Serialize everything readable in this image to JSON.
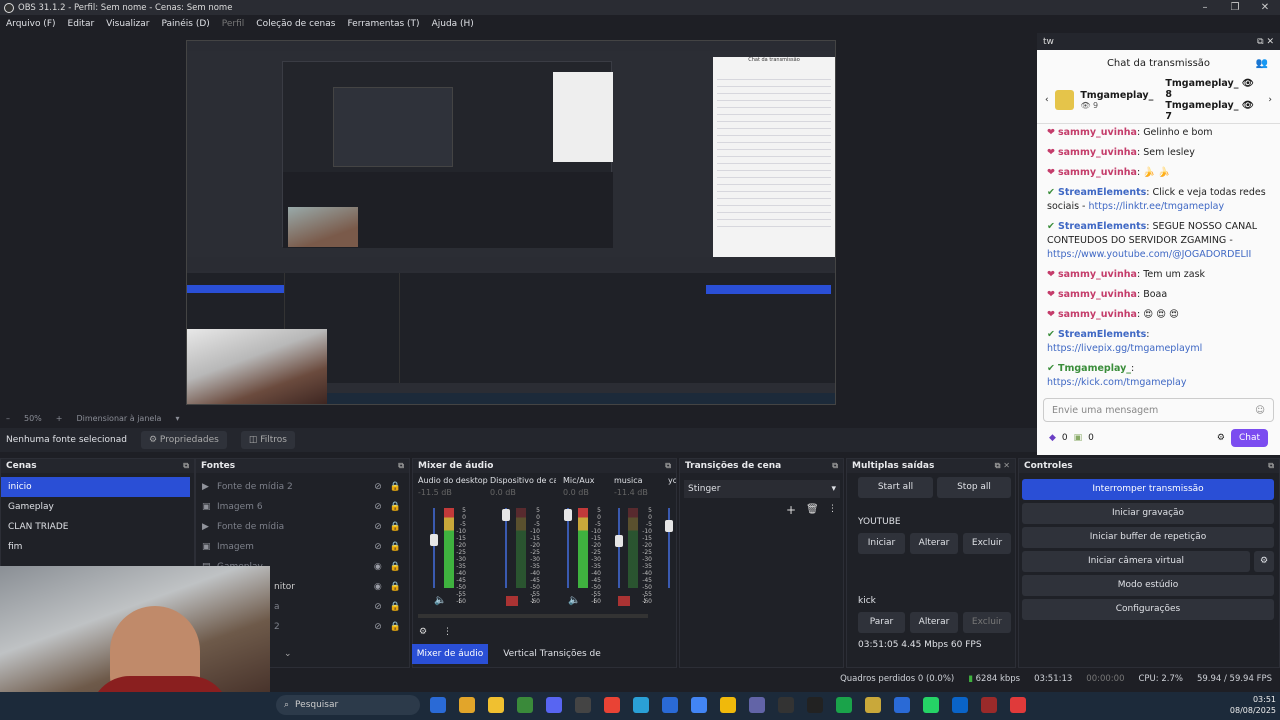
{
  "window": {
    "title": "OBS 31.1.2 - Perfil: Sem nome - Cenas: Sem nome"
  },
  "menu": [
    "Arquivo (F)",
    "Editar",
    "Visualizar",
    "Painéis (D)",
    "Perfil",
    "Coleção de cenas",
    "Ferramentas (T)",
    "Ajuda (H)"
  ],
  "zoom": {
    "percent": "50%",
    "mode": "Dimensionar à janela"
  },
  "source_bar": {
    "no_source": "Nenhuma fonte selecionad",
    "properties": "Propriedades",
    "filters": "Filtros"
  },
  "scenes": {
    "title": "Cenas",
    "items": [
      "inicio",
      "Gameplay",
      "CLAN TRIADE",
      "fim"
    ],
    "active": 0
  },
  "sources": {
    "title": "Fontes",
    "items": [
      {
        "icon": "play-icon",
        "label": "Fonte de mídia 2"
      },
      {
        "icon": "image-icon",
        "label": "Imagem 6"
      },
      {
        "icon": "play-icon",
        "label": "Fonte de mídia"
      },
      {
        "icon": "image-icon",
        "label": "Imagem"
      },
      {
        "icon": "scene-icon",
        "label": "Gameplay"
      },
      {
        "icon": "monitor-icon",
        "label": "nitor"
      },
      {
        "icon": "image-icon",
        "label": "a"
      },
      {
        "icon": "image-icon",
        "label": "2"
      }
    ]
  },
  "mixer": {
    "title": "Mixer de áudio",
    "channels": [
      {
        "name": "Áudio do desktop",
        "db": "-11.5 dB",
        "level": 0.55
      },
      {
        "name": "Dispositivo de capt",
        "db": "0.0 dB",
        "level": 0.0
      },
      {
        "name": "Mic/Aux",
        "db": "0.0 dB",
        "level": 0.9
      },
      {
        "name": "musica",
        "db": "-11.4 dB",
        "level": 0.3
      },
      {
        "name": "yo",
        "db": "",
        "level": 0.0
      }
    ],
    "scale": [
      "5",
      "0",
      "-5",
      "-10",
      "-15",
      "-20",
      "-25",
      "-30",
      "-35",
      "-40",
      "-45",
      "-50",
      "-55",
      "-60"
    ],
    "tabs": [
      "Mixer de áudio",
      "Vertical Transições de cena"
    ]
  },
  "transitions": {
    "title": "Transições de cena",
    "selected": "Stinger"
  },
  "multi": {
    "title": "Multiplas saídas",
    "start_all": "Start all",
    "stop_all": "Stop all",
    "yt_label": "YOUTUBE",
    "yt_buttons": [
      "Iniciar",
      "Alterar",
      "Excluir"
    ],
    "kick_label": "kick",
    "kick_buttons": [
      "Parar",
      "Alterar",
      "Excluir"
    ],
    "kick_stats": "03:51:05  4.45 Mbps  60 FPS"
  },
  "controls": {
    "title": "Controles",
    "buttons": [
      "Interromper transmissão",
      "Iniciar gravação",
      "Iniciar buffer de repetição",
      "Iniciar câmera virtual",
      "Modo estúdio",
      "Configurações"
    ]
  },
  "chat": {
    "dock": "tw",
    "title": "Chat da transmissão",
    "streamers": [
      {
        "name": "Tmgameplay_",
        "count": "9"
      },
      {
        "name": "Tmgameplay_",
        "count": "8"
      },
      {
        "name": "Tmgameplay_",
        "count": "7"
      }
    ],
    "messages": [
      {
        "user": "sammy_uvinha",
        "color": "red",
        "text": "Gelinho e bom"
      },
      {
        "user": "sammy_uvinha",
        "color": "red",
        "text": "Sem lesley"
      },
      {
        "user": "sammy_uvinha",
        "color": "red",
        "text": "🍌 🍌"
      },
      {
        "user": "StreamElements",
        "color": "blue",
        "text": "Click e veja todas redes sociais - ",
        "link": "https://linktr.ee/tmgameplay"
      },
      {
        "user": "StreamElements",
        "color": "blue",
        "text": "SEGUE NOSSO CANAL CONTEUDOS DO SERVIDOR ZGAMING - ",
        "link": "https://www.youtube.com/@JOGADORDELII"
      },
      {
        "user": "sammy_uvinha",
        "color": "red",
        "text": "Tem um zask"
      },
      {
        "user": "sammy_uvinha",
        "color": "red",
        "text": "Boaa"
      },
      {
        "user": "sammy_uvinha",
        "color": "red",
        "text": "😍 😍 😍"
      },
      {
        "user": "StreamElements",
        "color": "blue",
        "text": "",
        "link": "https://livepix.gg/tmgameplayml"
      },
      {
        "user": "Tmgameplay_",
        "color": "green",
        "text": "",
        "link": "https://kick.com/tmgameplay"
      }
    ],
    "input_placeholder": "Envie uma mensagem",
    "count_a": "0",
    "count_b": "0",
    "chat_button": "Chat"
  },
  "status": {
    "dropped": "Quadros perdidos 0 (0.0%)",
    "kbps": "6284 kbps",
    "live": "03:51:13",
    "rec": "00:00:00",
    "cpu": "CPU: 2.7%",
    "fps": "59.94 / 59.94 FPS"
  },
  "taskbar": {
    "search": "Pesquisar",
    "time": "03:51",
    "date": "08/08/2025"
  }
}
